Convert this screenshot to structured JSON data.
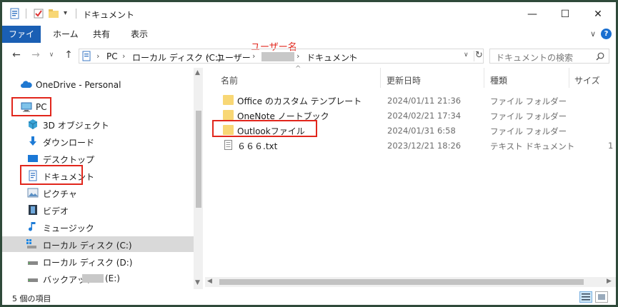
{
  "window": {
    "title": "ドキュメント",
    "controls": {
      "minimize": "—",
      "maximize": "☐",
      "close": "✕"
    }
  },
  "ribbon": {
    "tabs": [
      "ファイル",
      "ホーム",
      "共有",
      "表示"
    ],
    "help": "?"
  },
  "address": {
    "crumbs": [
      "PC",
      "ローカル ディスク (C:)",
      "ユーザー",
      "ドキュメント"
    ],
    "search_placeholder": "ドキュメントの検索"
  },
  "annotation": "ユーザー名",
  "sidebar": {
    "items": [
      {
        "label": "OneDrive - Personal",
        "icon": "cloud-icon"
      },
      {
        "label": "PC",
        "icon": "computer-icon"
      },
      {
        "label": "3D オブジェクト",
        "icon": "cube-icon"
      },
      {
        "label": "ダウンロード",
        "icon": "download-icon"
      },
      {
        "label": "デスクトップ",
        "icon": "desktop-icon"
      },
      {
        "label": "ドキュメント",
        "icon": "document-icon"
      },
      {
        "label": "ピクチャ",
        "icon": "picture-icon"
      },
      {
        "label": "ビデオ",
        "icon": "video-icon"
      },
      {
        "label": "ミュージック",
        "icon": "music-icon"
      },
      {
        "label": "ローカル ディスク (C:)",
        "icon": "drive-icon"
      },
      {
        "label": "ローカル ディスク (D:)",
        "icon": "drive-icon"
      },
      {
        "label": "バックアップ-",
        "suffix": "(E:)",
        "icon": "drive-icon"
      }
    ]
  },
  "columns": {
    "name": "名前",
    "modified": "更新日時",
    "type": "種類",
    "size": "サイズ"
  },
  "files": [
    {
      "name": "Office のカスタム テンプレート",
      "modified": "2024/01/11 21:36",
      "type": "ファイル フォルダー",
      "size": ""
    },
    {
      "name": "OneNote ノートブック",
      "modified": "2024/02/21 17:34",
      "type": "ファイル フォルダー",
      "size": ""
    },
    {
      "name": "Outlookファイル",
      "modified": "2024/01/31 6:58",
      "type": "ファイル フォルダー",
      "size": ""
    },
    {
      "name": "６６６.txt",
      "modified": "2023/12/21 18:26",
      "type": "テキスト ドキュメント",
      "size": "1"
    }
  ],
  "status": {
    "count": "5 個の項目"
  },
  "colors": {
    "accent": "#1a5fb4",
    "highlight": "#e1261c",
    "folder": "#f8d775"
  }
}
